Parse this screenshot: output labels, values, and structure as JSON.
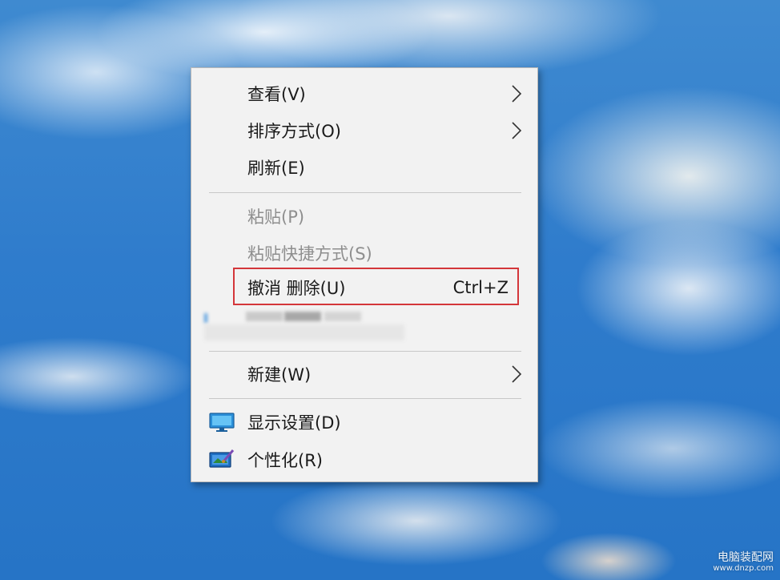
{
  "context_menu": {
    "items": [
      {
        "label": "查看(V)",
        "has_submenu": true,
        "enabled": true
      },
      {
        "label": "排序方式(O)",
        "has_submenu": true,
        "enabled": true
      },
      {
        "label": "刷新(E)",
        "has_submenu": false,
        "enabled": true
      },
      {
        "label": "粘贴(P)",
        "has_submenu": false,
        "enabled": false
      },
      {
        "label": "粘贴快捷方式(S)",
        "has_submenu": false,
        "enabled": false
      },
      {
        "label": "撤消 删除(U)",
        "shortcut": "Ctrl+Z",
        "has_submenu": false,
        "enabled": true,
        "highlighted": true
      },
      {
        "label": "新建(W)",
        "has_submenu": true,
        "enabled": true
      },
      {
        "label": "显示设置(D)",
        "icon": "display-icon",
        "enabled": true
      },
      {
        "label": "个性化(R)",
        "icon": "personalize-icon",
        "enabled": true
      }
    ],
    "highlight_color": "#d4363a"
  },
  "watermark": {
    "text": "电脑装配网",
    "url": "www.dnzp.com"
  }
}
